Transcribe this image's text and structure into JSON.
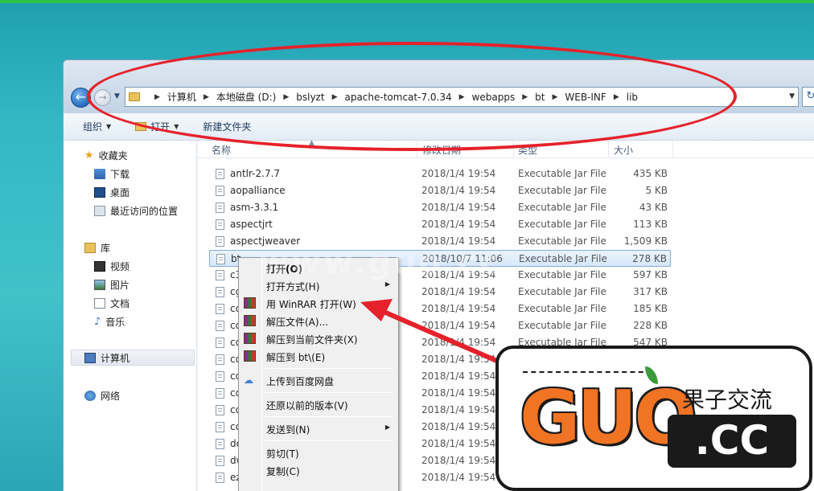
{
  "address_bar": {
    "breadcrumbs": [
      "计算机",
      "本地磁盘 (D:)",
      "bslyzt",
      "apache-tomcat-7.0.34",
      "webapps",
      "bt",
      "WEB-INF",
      "lib"
    ]
  },
  "toolbar": {
    "organize": "组织",
    "open": "打开",
    "new_folder": "新建文件夹"
  },
  "nav": {
    "favorites": "收藏夹",
    "downloads": "下载",
    "desktop": "桌面",
    "recent": "最近访问的位置",
    "libraries": "库",
    "videos": "视频",
    "pictures": "图片",
    "documents": "文档",
    "music": "音乐",
    "computer": "计算机",
    "network": "网络"
  },
  "columns": {
    "name": "名称",
    "date": "修改日期",
    "type": "类型",
    "size": "大小"
  },
  "files": [
    {
      "name": "antlr-2.7.7",
      "date": "2018/1/4 19:54",
      "type": "Executable Jar File",
      "size": "435 KB"
    },
    {
      "name": "aopalliance",
      "date": "2018/1/4 19:54",
      "type": "Executable Jar File",
      "size": "5 KB"
    },
    {
      "name": "asm-3.3.1",
      "date": "2018/1/4 19:54",
      "type": "Executable Jar File",
      "size": "43 KB"
    },
    {
      "name": "aspectjrt",
      "date": "2018/1/4 19:54",
      "type": "Executable Jar File",
      "size": "113 KB"
    },
    {
      "name": "aspectjweaver",
      "date": "2018/1/4 19:54",
      "type": "Executable Jar File",
      "size": "1,509 KB"
    },
    {
      "name": "bt",
      "date": "2018/10/7 11:06",
      "type": "Executable Jar File",
      "size": "278 KB"
    },
    {
      "name": "c3",
      "date": "2018/1/4 19:54",
      "type": "Executable Jar File",
      "size": "597 KB"
    },
    {
      "name": "cg",
      "date": "2018/1/4 19:54",
      "type": "Executable Jar File",
      "size": "317 KB"
    },
    {
      "name": "co",
      "date": "2018/1/4 19:54",
      "type": "Executable Jar File",
      "size": "185 KB"
    },
    {
      "name": "co",
      "date": "2018/1/4 19:54",
      "type": "Executable Jar File",
      "size": "228 KB"
    },
    {
      "name": "co",
      "date": "2018/1/4 19:54",
      "type": "Executable Jar File",
      "size": "547 KB"
    },
    {
      "name": "co",
      "date": "2018/1/4 19:54",
      "type": "",
      "size": ""
    },
    {
      "name": "co",
      "date": "2018/1/4 19:54",
      "type": "",
      "size": ""
    },
    {
      "name": "co",
      "date": "2018/1/4 19:54",
      "type": "",
      "size": ""
    },
    {
      "name": "co",
      "date": "2018/1/4 19:54",
      "type": "",
      "size": ""
    },
    {
      "name": "co",
      "date": "2018/1/4 19:54",
      "type": "",
      "size": ""
    },
    {
      "name": "do",
      "date": "2018/1/4 19:54",
      "type": "",
      "size": ""
    },
    {
      "name": "dw",
      "date": "2018/1/4 19:54",
      "type": "",
      "size": ""
    },
    {
      "name": "ez",
      "date": "2018/1/4 19:54",
      "type": "",
      "size": ""
    }
  ],
  "context_menu": {
    "open": "打开(O)",
    "open_with": "打开方式(H)",
    "winrar_open": "用 WinRAR 打开(W)",
    "extract_files": "解压文件(A)...",
    "extract_here": "解压到当前文件夹(X)",
    "extract_to": "解压到 bt\\(E)",
    "upload_baidu": "上传到百度网盘",
    "restore_prev": "还原以前的版本(V)",
    "send_to": "发送到(N)",
    "cut": "剪切(T)",
    "copy": "复制(C)"
  },
  "watermark": {
    "logo_latin": "GUO",
    "logo_cn": "果子交流",
    "logo_domain": ".CC",
    "overlay_text": "www.guo.cc"
  },
  "colors": {
    "annotation_red": "#e5222b",
    "logo_orange": "#f07424",
    "selection_border": "#84acdd"
  }
}
